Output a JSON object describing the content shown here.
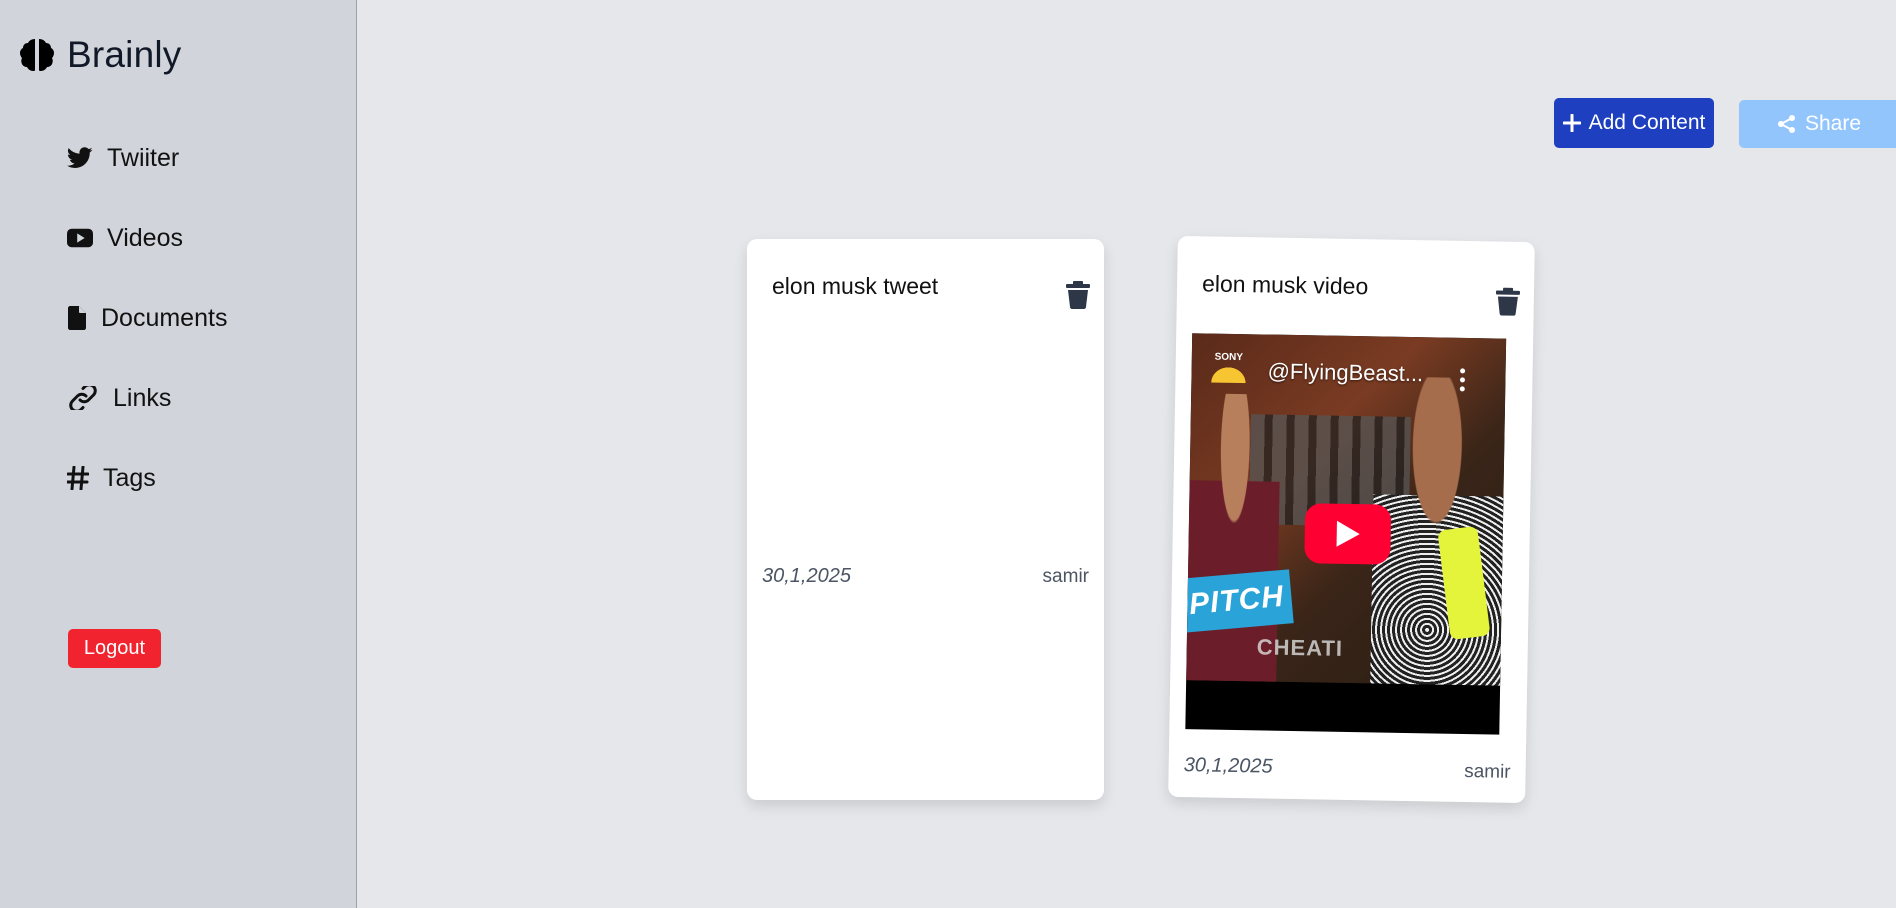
{
  "sidebar": {
    "brand": "Brainly",
    "items": [
      {
        "label": "Twiiter",
        "icon": "twitter-icon"
      },
      {
        "label": "Videos",
        "icon": "youtube-icon"
      },
      {
        "label": "Documents",
        "icon": "document-icon"
      },
      {
        "label": "Links",
        "icon": "link-icon"
      },
      {
        "label": "Tags",
        "icon": "hash-icon"
      }
    ],
    "logout_label": "Logout"
  },
  "toolbar": {
    "add_label": "Add Content",
    "share_label": "Share"
  },
  "cards": [
    {
      "title": "elon musk tweet",
      "date": "30,1,2025",
      "author": "samir"
    },
    {
      "title": "elon musk video",
      "date": "30,1,2025",
      "author": "samir",
      "video": {
        "channel": "@FlyingBeast...",
        "logo_text": "SONY",
        "overlay_text": "PITCH",
        "overlay_text_2": "CHEATI"
      }
    }
  ],
  "colors": {
    "sidebar_bg": "#d1d5db",
    "main_bg": "#e5e7eb",
    "primary": "#1e3fbf",
    "secondary": "#93c5fd",
    "danger": "#f0232f"
  }
}
